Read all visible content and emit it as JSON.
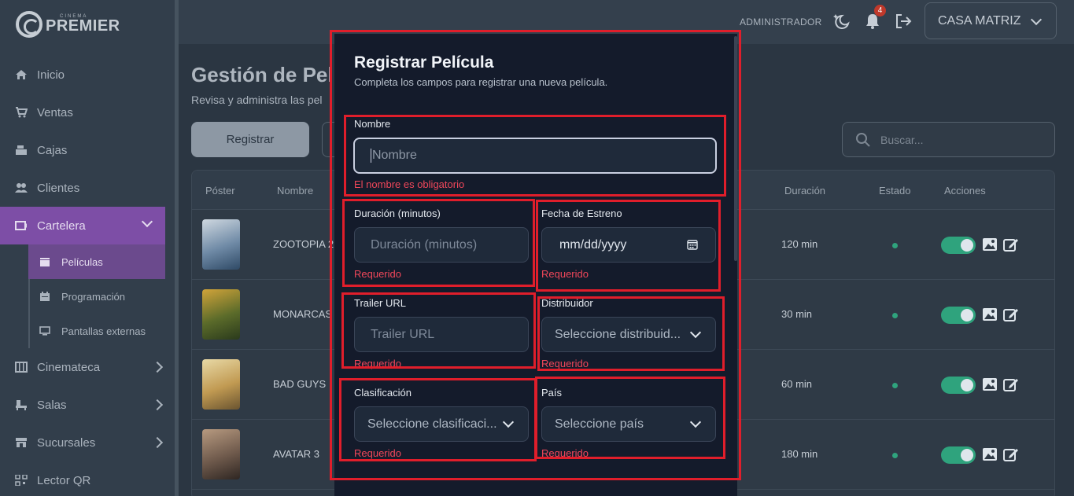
{
  "brand": {
    "small": "CINEMA",
    "name": "PREMIER"
  },
  "sidebar": {
    "items": [
      {
        "label": "Inicio",
        "icon": "home-icon"
      },
      {
        "label": "Ventas",
        "icon": "cart-icon"
      },
      {
        "label": "Cajas",
        "icon": "cash-register-icon"
      },
      {
        "label": "Clientes",
        "icon": "users-icon"
      },
      {
        "label": "Cartelera",
        "icon": "ticket-icon"
      },
      {
        "label": "Cinemateca",
        "icon": "film-icon"
      },
      {
        "label": "Salas",
        "icon": "seats-icon"
      },
      {
        "label": "Sucursales",
        "icon": "store-icon"
      },
      {
        "label": "Lector QR",
        "icon": "qr-icon"
      }
    ],
    "subitems": [
      {
        "label": "Películas",
        "icon": "clapperboard-icon"
      },
      {
        "label": "Programación",
        "icon": "calendar-icon"
      },
      {
        "label": "Pantallas externas",
        "icon": "monitor-icon"
      }
    ]
  },
  "header": {
    "user": "ADMINISTRADOR",
    "notifications": "4",
    "branch": "CASA MATRIZ"
  },
  "page": {
    "title": "Gestión de Pel",
    "subtitle": "Revisa y administra las pel",
    "register_button": "Registrar",
    "search_placeholder": "Buscar..."
  },
  "table": {
    "columns": {
      "poster": "Póster",
      "name": "Nombre",
      "duration": "Duración",
      "status": "Estado",
      "actions": "Acciones"
    },
    "rows": [
      {
        "name": "ZOOTOPIA 2",
        "duration": "120 min"
      },
      {
        "name": "MONARCAS",
        "duration": "30 min"
      },
      {
        "name": "BAD GUYS",
        "duration": "60 min"
      },
      {
        "name": "AVATAR 3",
        "duration": "180 min"
      }
    ]
  },
  "modal": {
    "title": "Registrar Película",
    "subtitle": "Completa los campos para registrar una nueva película.",
    "fields": {
      "nombre": {
        "label": "Nombre",
        "placeholder": "Nombre",
        "error": "El nombre es obligatorio"
      },
      "duracion": {
        "label": "Duración (minutos)",
        "placeholder": "Duración (minutos)",
        "error": "Requerido"
      },
      "fecha": {
        "label": "Fecha de Estreno",
        "value": "mm/dd/yyyy",
        "error": "Requerido"
      },
      "trailer": {
        "label": "Trailer URL",
        "placeholder": "Trailer URL",
        "error": "Requerido"
      },
      "distribuidor": {
        "label": "Distribuidor",
        "value": "Seleccione distribuid...",
        "error": "Requerido"
      },
      "clasificacion": {
        "label": "Clasificación",
        "value": "Seleccione clasificaci...",
        "error": "Requerido"
      },
      "pais": {
        "label": "País",
        "value": "Seleccione país",
        "error": "Requerido"
      }
    }
  },
  "colors": {
    "accent": "#7d4ea6",
    "error": "#f0475a",
    "highlight": "#e01e2b",
    "status_active": "#2fa37d"
  }
}
